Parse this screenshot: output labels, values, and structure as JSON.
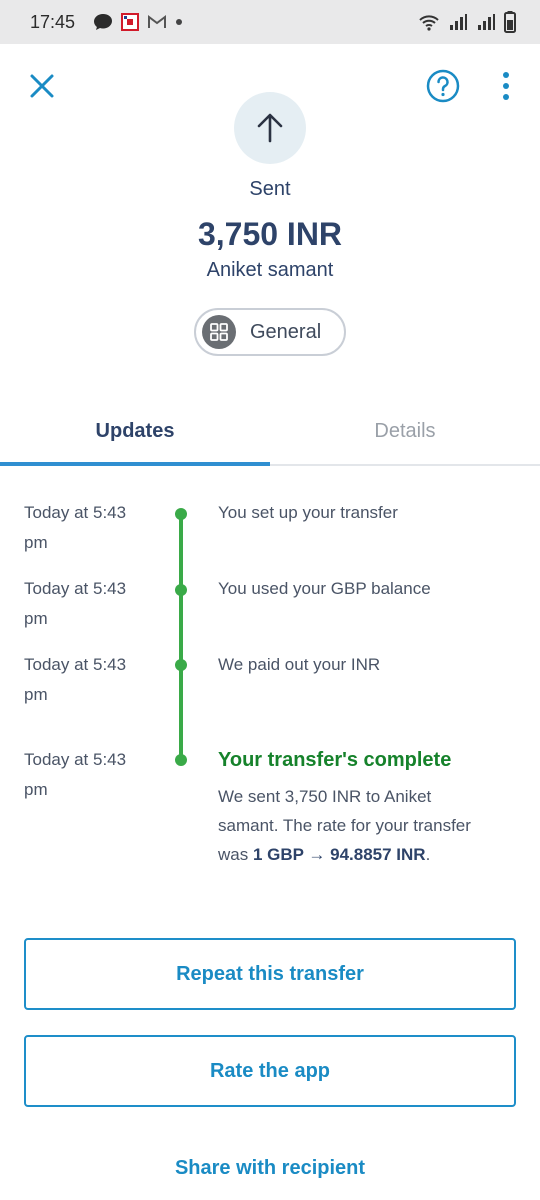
{
  "status_bar": {
    "time": "17:45"
  },
  "header": {
    "close_icon": "close-icon",
    "help_icon": "help-icon",
    "more_icon": "more-vertical-icon"
  },
  "transfer": {
    "status_label": "Sent",
    "amount": "3,750 INR",
    "recipient": "Aniket samant",
    "category": "General"
  },
  "tabs": {
    "updates": "Updates",
    "details": "Details",
    "active": "Updates"
  },
  "timeline": [
    {
      "time_line1": "Today at 5:43",
      "time_line2": "pm",
      "text": "You set up your transfer"
    },
    {
      "time_line1": "Today at 5:43",
      "time_line2": "pm",
      "text": "You used your GBP balance"
    },
    {
      "time_line1": "Today at 5:43",
      "time_line2": "pm",
      "text": "We paid out your INR"
    },
    {
      "time_line1": "Today at 5:43",
      "time_line2": "pm",
      "title": "Your transfer's complete",
      "desc_line1": "We sent 3,750 INR to Aniket",
      "desc_line2": "samant. The rate for your transfer",
      "desc_prefix": "was ",
      "rate": "1 GBP → 94.8857 INR",
      "desc_suffix": "."
    }
  ],
  "actions": {
    "repeat": "Repeat this transfer",
    "rate_app": "Rate the app",
    "share": "Share with recipient"
  },
  "colors": {
    "accent": "#1a8bc4",
    "navy": "#2e4369",
    "success": "#16822b",
    "timeline": "#3aaa48"
  }
}
